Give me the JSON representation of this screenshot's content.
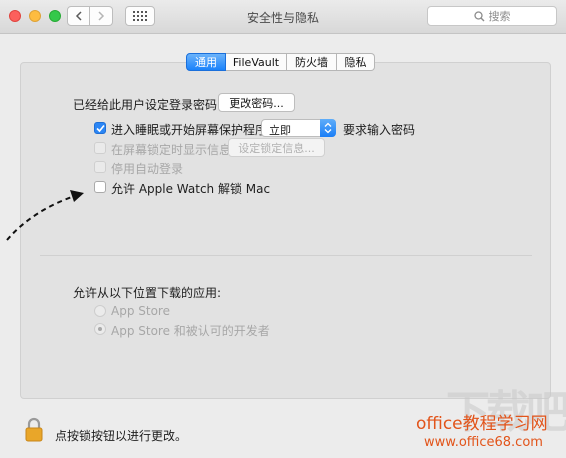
{
  "window": {
    "title": "安全性与隐私"
  },
  "toolbar": {
    "search_placeholder": "搜索"
  },
  "tabs": [
    {
      "label": "通用",
      "active": true
    },
    {
      "label": "FileVault",
      "active": false
    },
    {
      "label": "防火墙",
      "active": false
    },
    {
      "label": "隐私",
      "active": false
    }
  ],
  "general": {
    "password_label": "已经给此用户设定登录密码",
    "change_password_button": "更改密码...",
    "require_password_label": "进入睡眠或开始屏幕保护程序",
    "require_password_checked": true,
    "require_password_delay": "立即",
    "require_password_suffix": "要求输入密码",
    "lock_message_label": "在屏幕锁定时显示信息",
    "lock_message_button": "设定锁定信息...",
    "auto_login_label": "停用自动登录",
    "apple_watch_label": "允许 Apple Watch 解锁 Mac",
    "apple_watch_checked": false
  },
  "downloads": {
    "heading": "允许从以下位置下载的应用:",
    "options": [
      {
        "label": "App Store",
        "selected": false
      },
      {
        "label": "App Store 和被认可的开发者",
        "selected": true
      }
    ]
  },
  "footer": {
    "lock_text": "点按锁按钮以进行更改。"
  },
  "watermark": {
    "site_cn": "office教程学习网",
    "url": "www.office68.com"
  },
  "colors": {
    "accent": "#1a82fb",
    "watermark": "#e2541a"
  },
  "icons": [
    "close-icon",
    "minimize-icon",
    "maximize-icon",
    "back-icon",
    "forward-icon",
    "grid-icon",
    "search-icon",
    "lock-icon",
    "arrow-annotation-icon"
  ]
}
